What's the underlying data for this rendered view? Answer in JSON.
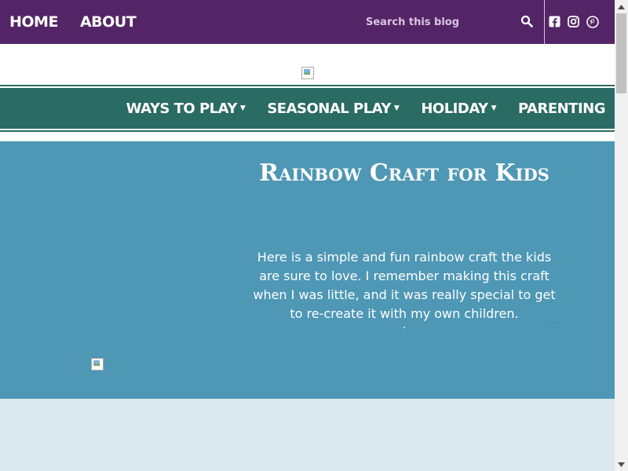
{
  "topnav": {
    "items": [
      "HOME",
      "ABOUT"
    ]
  },
  "search": {
    "placeholder": "Search this blog"
  },
  "social": {
    "icons": [
      "facebook-icon",
      "instagram-icon",
      "pinterest-icon"
    ]
  },
  "mainnav": {
    "items": [
      {
        "label": "WAYS TO PLAY",
        "dropdown": true
      },
      {
        "label": "SEASONAL PLAY",
        "dropdown": true
      },
      {
        "label": "HOLIDAY",
        "dropdown": true
      },
      {
        "label": "PARENTING",
        "dropdown": false
      }
    ]
  },
  "hero": {
    "title": "Rainbow Craft for Kids",
    "text": "Here is a simple and fun rainbow craft the kids are sure to love.   I remember making this craft when I was little, and it was really special to get to re-create it with my own children.",
    "more": "..."
  },
  "colors": {
    "topbar": "#542566",
    "nav": "#2a6b63",
    "hero": "#4e97b5",
    "lower": "#dce9ee"
  }
}
